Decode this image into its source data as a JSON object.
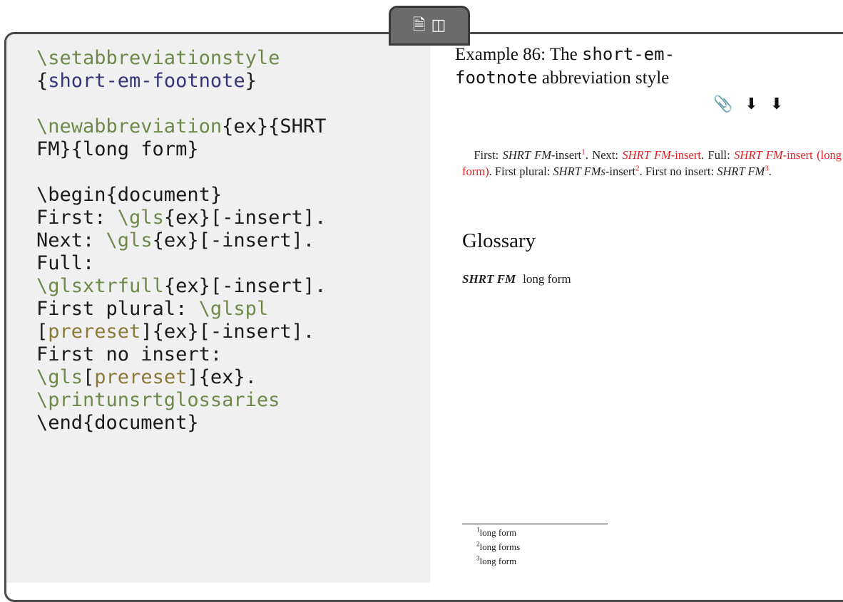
{
  "toolbar": {
    "icons": [
      "source-file-icon",
      "pdf-file-icon"
    ]
  },
  "code": {
    "lines": [
      [
        {
          "t": "\\setabbreviationstyle",
          "c": "cs"
        }
      ],
      [
        {
          "t": "{",
          "c": ""
        },
        {
          "t": "short-em-footnote",
          "c": "arg"
        },
        {
          "t": "}",
          "c": ""
        }
      ],
      [],
      [
        {
          "t": "\\newabbreviation",
          "c": "cs"
        },
        {
          "t": "{ex}{SHRT",
          "c": ""
        }
      ],
      [
        {
          "t": "FM}{long form}",
          "c": ""
        }
      ],
      [],
      [
        {
          "t": "\\begin{document}",
          "c": ""
        }
      ],
      [
        {
          "t": "First: ",
          "c": ""
        },
        {
          "t": "\\gls",
          "c": "cs"
        },
        {
          "t": "{ex}[-insert].",
          "c": ""
        }
      ],
      [
        {
          "t": "Next: ",
          "c": ""
        },
        {
          "t": "\\gls",
          "c": "cs"
        },
        {
          "t": "{ex}[-insert].",
          "c": ""
        }
      ],
      [
        {
          "t": "Full:",
          "c": ""
        }
      ],
      [
        {
          "t": "\\glsxtrfull",
          "c": "cs"
        },
        {
          "t": "{ex}[-insert].",
          "c": ""
        }
      ],
      [
        {
          "t": "First plural: ",
          "c": ""
        },
        {
          "t": "\\glspl",
          "c": "cs"
        }
      ],
      [
        {
          "t": "[",
          "c": ""
        },
        {
          "t": "prereset",
          "c": "opt"
        },
        {
          "t": "]{ex}[-insert].",
          "c": ""
        }
      ],
      [
        {
          "t": "First no insert:",
          "c": ""
        }
      ],
      [
        {
          "t": "\\gls",
          "c": "cs"
        },
        {
          "t": "[",
          "c": ""
        },
        {
          "t": "prereset",
          "c": "opt"
        },
        {
          "t": "]{ex}.",
          "c": ""
        }
      ],
      [
        {
          "t": "\\printunsrtglossaries",
          "c": "cs"
        }
      ],
      [
        {
          "t": "\\end{document}",
          "c": ""
        }
      ]
    ]
  },
  "example": {
    "title_prefix": "Example 86: The ",
    "title_style_part1": "short-em-",
    "title_style_part2": "footnote",
    "title_suffix": " abbreviation style",
    "icons": [
      "attachment-icon",
      "download-source-icon",
      "download-pdf-icon"
    ]
  },
  "output": {
    "first_label": "First: ",
    "short": "SHRT FM",
    "short_plural": "SHRT FMs",
    "insert": "-insert",
    "fn1": "1",
    "fn2": "2",
    "fn3": "3",
    "next_label": "Next: ",
    "full_label": "Full: ",
    "full_long": " (long form)",
    "plural_label": "First plural: ",
    "noinsert_label": "First no insert: ",
    "glossary_heading": "Glossary",
    "glossary_term": "SHRT FM",
    "glossary_desc": "long form"
  },
  "footnotes": [
    {
      "num": "1",
      "text": "long form"
    },
    {
      "num": "2",
      "text": "long forms"
    },
    {
      "num": "3",
      "text": "long form"
    }
  ]
}
